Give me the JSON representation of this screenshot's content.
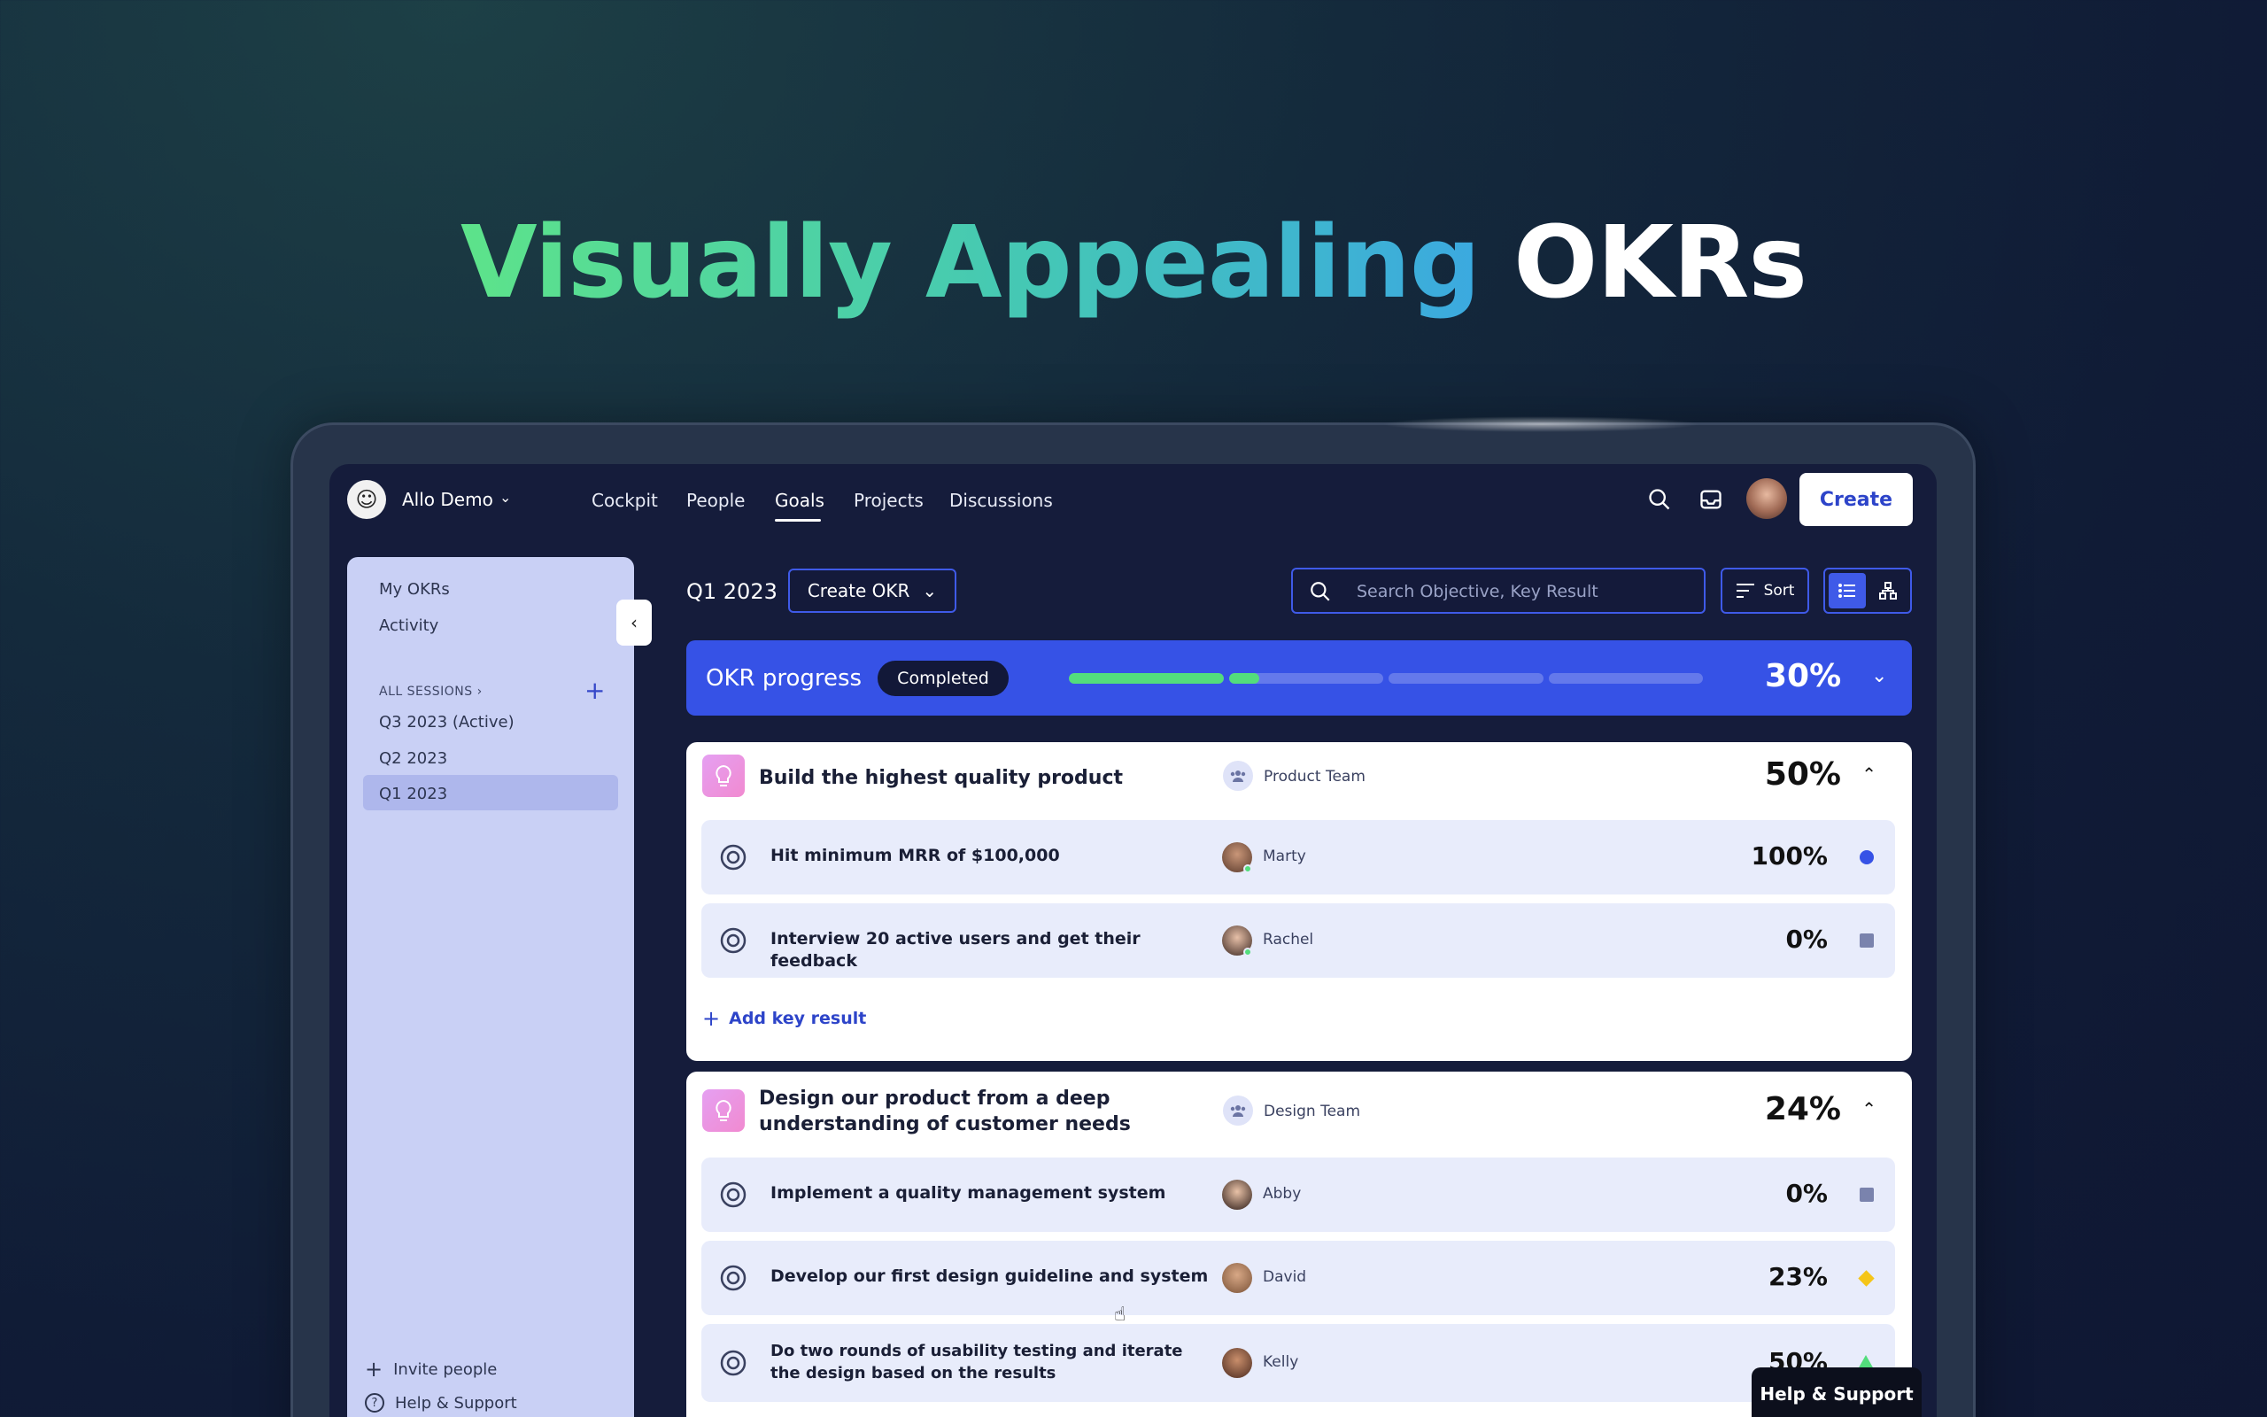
{
  "hero": {
    "part1": "Visually Appealing",
    "part2": "OKRs"
  },
  "workspace": {
    "name": "Allo Demo"
  },
  "nav": {
    "cockpit": "Cockpit",
    "people": "People",
    "goals": "Goals",
    "projects": "Projects",
    "discussions": "Discussions"
  },
  "header": {
    "create": "Create"
  },
  "sidebar": {
    "my_okrs": "My OKRs",
    "activity": "Activity",
    "all_sessions": "ALL SESSIONS",
    "sessions": [
      "Q3 2023 (Active)",
      "Q2 2023",
      "Q1 2023"
    ],
    "invite": "Invite people",
    "help": "Help & Support"
  },
  "toolbar": {
    "session": "Q1 2023",
    "create_okr": "Create OKR",
    "search_placeholder": "Search Objective, Key Result",
    "sort": "Sort"
  },
  "progress": {
    "label": "OKR progress",
    "badge": "Completed",
    "percent": "30%",
    "segments": [
      1.0,
      0.2,
      0,
      0
    ]
  },
  "objectives": [
    {
      "title": "Build the highest quality product",
      "team": "Product Team",
      "percent": "50%",
      "key_results": [
        {
          "title": "Hit minimum MRR of $100,000",
          "owner": "Marty",
          "percent": "100%",
          "status": "circle"
        },
        {
          "title": "Interview 20 active users and get their feedback",
          "owner": "Rachel",
          "percent": "0%",
          "status": "square"
        }
      ],
      "add_kr": "Add key result"
    },
    {
      "title": "Design our product from a deep understanding of customer needs",
      "team": "Design Team",
      "percent": "24%",
      "key_results": [
        {
          "title": "Implement a quality management system",
          "owner": "Abby",
          "percent": "0%",
          "status": "square"
        },
        {
          "title": "Develop our first design guideline and system",
          "owner": "David",
          "percent": "23%",
          "status": "diamond"
        },
        {
          "title": "Do two rounds of usability testing and iterate the design based on the results",
          "owner": "Kelly",
          "percent": "50%",
          "status": "triangle"
        }
      ]
    }
  ],
  "help_float": "Help & Support",
  "colors": {
    "accent": "#3652e6",
    "progress_fill": "#53dd7c",
    "sidebar": "#c9d0f5"
  }
}
